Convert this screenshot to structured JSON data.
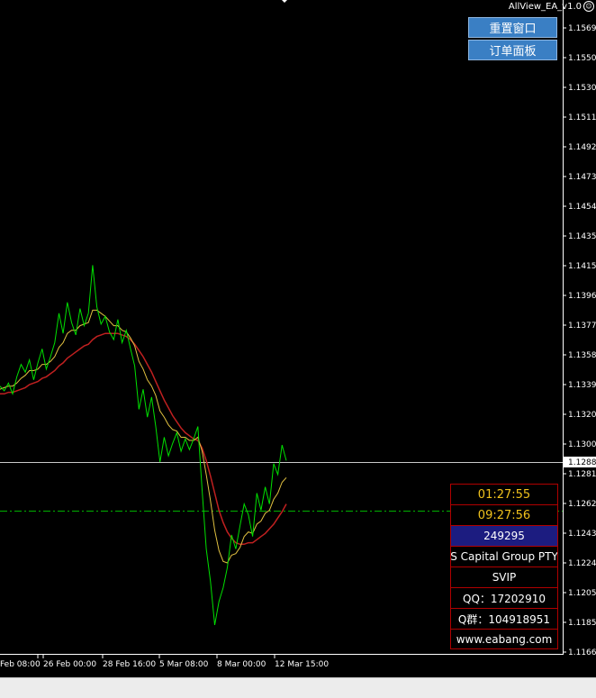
{
  "ea": {
    "title": "AllView_EA_v1.0",
    "buttons": {
      "reset_window": "重置窗口",
      "order_panel": "订单面板"
    }
  },
  "price_axis": {
    "labels": [
      "1.15690",
      "1.15500",
      "1.15305",
      "1.15115",
      "1.14925",
      "1.14730",
      "1.14540",
      "1.14350",
      "1.14155",
      "1.13965",
      "1.13775",
      "1.13580",
      "1.13390",
      "1.13200",
      "1.13005",
      "1.12815",
      "1.12625",
      "1.12430",
      "1.12240",
      "1.12050",
      "1.11855",
      "1.11665"
    ],
    "current_price": "1.12888"
  },
  "time_axis": {
    "labels": [
      "Feb 08:00",
      "26 Feb 00:00",
      "28 Feb 16:00",
      "5 Mar 08:00",
      "8 Mar 00:00",
      "12 Mar 15:00"
    ]
  },
  "info_panel": {
    "time1": "01:27:55",
    "time2": "09:27:56",
    "account": "249295",
    "broker": "S Capital Group PTY",
    "level": "SVIP",
    "qq": "QQ：17202910",
    "qgroup": "Q群：104918951",
    "website": "www.eabang.com"
  },
  "colors": {
    "price_line": "#00e000",
    "ma_fast": "#e0c040",
    "ma_slow": "#c02020",
    "current_price_line": "#c8c8c8",
    "level_line": "#00b000",
    "axis": "#ffffff"
  },
  "chart_data": {
    "type": "line",
    "symbol_axis_range": [
      1.11665,
      1.1569
    ],
    "series": [
      {
        "values": [
          1.1338,
          1.1335,
          1.134,
          1.1333,
          1.1344,
          1.1352,
          1.1347,
          1.1355,
          1.1342,
          1.1353,
          1.1362,
          1.1349,
          1.1357,
          1.1366,
          1.1385,
          1.1372,
          1.1392,
          1.1379,
          1.1371,
          1.1388,
          1.1377,
          1.1385,
          1.1416,
          1.1389,
          1.1378,
          1.1383,
          1.1373,
          1.1368,
          1.1381,
          1.1366,
          1.1374,
          1.1362,
          1.1351,
          1.1323,
          1.1336,
          1.1318,
          1.1331,
          1.1312,
          1.1289,
          1.1305,
          1.1293,
          1.1301,
          1.1308,
          1.1296,
          1.1304,
          1.1297,
          1.1304,
          1.1312,
          1.1271,
          1.1233,
          1.1212,
          1.1184,
          1.1199,
          1.1208,
          1.1221,
          1.1242,
          1.1233,
          1.1248,
          1.1262,
          1.1255,
          1.1241,
          1.1269,
          1.1258,
          1.1273,
          1.1262,
          1.1288,
          1.1281,
          1.13,
          1.129
        ]
      },
      {
        "values": [
          1.1336,
          1.1337,
          1.1338,
          1.1338,
          1.134,
          1.1343,
          1.1345,
          1.1348,
          1.1348,
          1.1349,
          1.1352,
          1.1352,
          1.1354,
          1.1357,
          1.1363,
          1.1366,
          1.1372,
          1.1374,
          1.1374,
          1.1377,
          1.1378,
          1.1379,
          1.1387,
          1.1387,
          1.1385,
          1.1383,
          1.138,
          1.1377,
          1.1377,
          1.1374,
          1.1373,
          1.1369,
          1.1364,
          1.1354,
          1.1349,
          1.1342,
          1.1338,
          1.1332,
          1.1322,
          1.1318,
          1.1313,
          1.131,
          1.1309,
          1.1305,
          1.1305,
          1.1303,
          1.1303,
          1.1305,
          1.1296,
          1.1281,
          1.1264,
          1.1245,
          1.1232,
          1.1225,
          1.1224,
          1.1229,
          1.123,
          1.1234,
          1.1241,
          1.1244,
          1.1243,
          1.1249,
          1.1251,
          1.1256,
          1.1258,
          1.1265,
          1.1269,
          1.1276,
          1.1279
        ]
      },
      {
        "values": [
          1.1333,
          1.1333,
          1.1334,
          1.1334,
          1.1335,
          1.1336,
          1.1337,
          1.1339,
          1.134,
          1.1341,
          1.1343,
          1.1344,
          1.1346,
          1.1348,
          1.1351,
          1.1353,
          1.1356,
          1.1358,
          1.136,
          1.1362,
          1.1364,
          1.1365,
          1.1368,
          1.137,
          1.1371,
          1.1372,
          1.1372,
          1.1372,
          1.1372,
          1.1371,
          1.137,
          1.1368,
          1.1365,
          1.1361,
          1.1357,
          1.1352,
          1.1347,
          1.1341,
          1.1335,
          1.1329,
          1.1324,
          1.1319,
          1.1315,
          1.1311,
          1.1308,
          1.1306,
          1.1304,
          1.1303,
          1.1298,
          1.129,
          1.128,
          1.1269,
          1.1258,
          1.125,
          1.1244,
          1.124,
          1.1237,
          1.1236,
          1.1236,
          1.1237,
          1.1237,
          1.1239,
          1.1241,
          1.1243,
          1.1246,
          1.1249,
          1.1253,
          1.1257,
          1.1262
        ]
      }
    ]
  }
}
